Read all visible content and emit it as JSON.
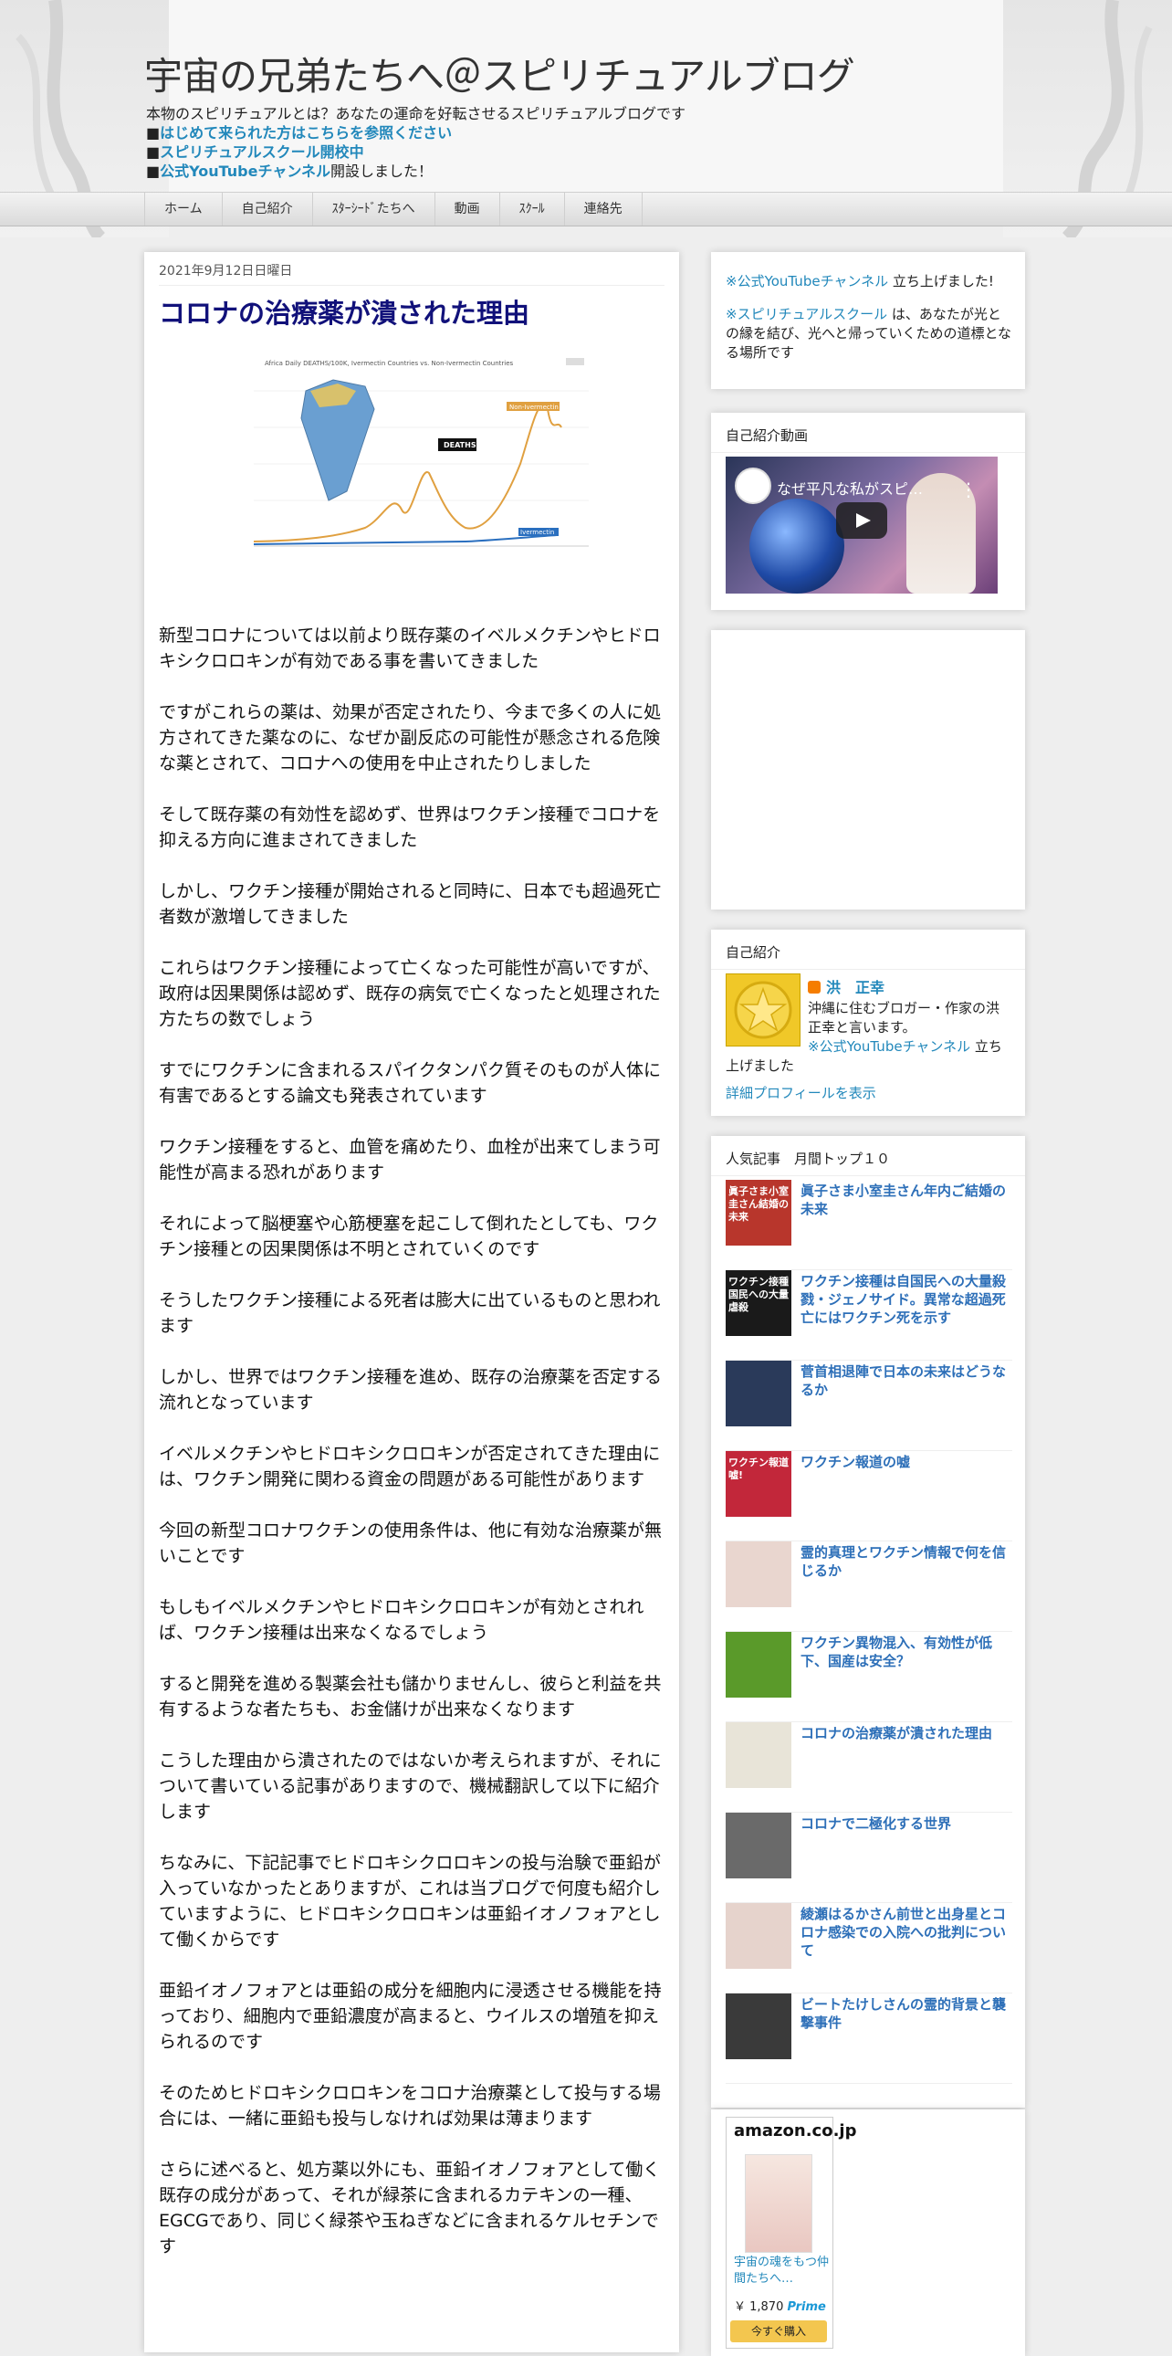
{
  "blog": {
    "title": "宇宙の兄弟たちへ＠スピリチュアルブログ",
    "description": "本物のスピリチュアルとは？あなたの運命を好転させるスピリチュアルブログです",
    "links": [
      {
        "bullet": "■",
        "text": "はじめて来られた方はこちらを参照ください",
        "suffix": ""
      },
      {
        "bullet": "■",
        "text": "スピリチュアルスクール開校中",
        "suffix": ""
      },
      {
        "bullet": "■",
        "text": "公式YouTubeチャンネル",
        "suffix": "開設しました！"
      }
    ]
  },
  "nav": {
    "tabs": [
      "ホーム",
      "自己紹介",
      "ｽﾀｰｼｰﾄﾞたちへ",
      "動画",
      "ｽｸｰﾙ",
      "連絡先"
    ]
  },
  "post": {
    "date": "2021年9月12日日曜日",
    "title": "コロナの治療薬が潰された理由",
    "image": {
      "chart_title": "Africa Daily DEATHS/100K, Ivermectin Countries vs. Non-Ivermectin Countries",
      "label_deaths": "DEATHS",
      "label_non": "Non-Ivermectin",
      "label_iver": "Ivermectin"
    },
    "paragraphs": [
      "新型コロナについては以前より既存薬のイベルメクチンやヒドロキシクロロキンが有効である事を書いてきました",
      "ですがこれらの薬は、効果が否定されたり、今まで多くの人に処方されてきた薬なのに、なぜか副反応の可能性が懸念される危険な薬とされて、コロナへの使用を中止されたりしました",
      "そして既存薬の有効性を認めず、世界はワクチン接種でコロナを抑える方向に進まされてきました",
      "しかし、ワクチン接種が開始されると同時に、日本でも超過死亡者数が激増してきました",
      "これらはワクチン接種によって亡くなった可能性が高いですが、政府は因果関係は認めず、既存の病気で亡くなったと処理された方たちの数でしょう",
      "すでにワクチンに含まれるスパイクタンパク質そのものが人体に有害であるとする論文も発表されています",
      "ワクチン接種をすると、血管を痛めたり、血栓が出来てしまう可能性が高まる恐れがあります",
      "それによって脳梗塞や心筋梗塞を起こして倒れたとしても、ワクチン接種との因果関係は不明とされていくのです",
      "そうしたワクチン接種による死者は膨大に出ているものと思われます",
      "しかし、世界ではワクチン接種を進め、既存の治療薬を否定する流れとなっています",
      "イベルメクチンやヒドロキシクロロキンが否定されてきた理由には、ワクチン開発に関わる資金の問題がある可能性があります",
      "今回の新型コロナワクチンの使用条件は、他に有効な治療薬が無いことです",
      "もしもイベルメクチンやヒドロキシクロロキンが有効とされれば、ワクチン接種は出来なくなるでしょう",
      "すると開発を進める製薬会社も儲かりませんし、彼らと利益を共有するような者たちも、お金儲けが出来なくなります",
      "こうした理由から潰されたのではないか考えられますが、それについて書いている記事がありますので、機械翻訳して以下に紹介します",
      "ちなみに、下記記事でヒドロキシクロロキンの投与治験で亜鉛が入っていなかったとありますが、これは当ブログで何度も紹介していますように、ヒドロキシクロロキンは亜鉛イオノフォアとして働くからです",
      "亜鉛イオノフォアとは亜鉛の成分を細胞内に浸透させる機能を持っており、細胞内で亜鉛濃度が高まると、ウイルスの増殖を抑えられるのです",
      "そのためヒドロキシクロロキンをコロナ治療薬として投与する場合には、一緒に亜鉛も投与しなければ効果は薄まります",
      "さらに述べると、処方薬以外にも、亜鉛イオノフォアとして働く既存の成分があって、それが緑茶に含まれるカテキンの一種、EGCGであり、同じく緑茶や玉ねぎなどに含まれるケルセチンです"
    ]
  },
  "sidebar": {
    "announce": {
      "item1_link": "※公式YouTubeチャンネル",
      "item1_text": " 立ち上げました!",
      "item2_link": "※スピリチュアルスクール",
      "item2_text": " は、あなたが光との縁を結び、光へと帰っていくための道標となる場所です"
    },
    "video": {
      "heading": "自己紹介動画",
      "title": "なぜ平凡な私がスピ…",
      "menu": "⋮"
    },
    "profile": {
      "heading": "自己紹介",
      "name": "洪　正幸",
      "text_lines": [
        "沖縄に住むブロガー・作家の洪",
        "正幸と言います。",
        "※公式YouTubeチャンネル"
      ],
      "text_tail": " 立ち",
      "text_end": "上げました",
      "link": "詳細プロフィールを表示"
    },
    "popular": {
      "heading": "人気記事　月間トップ１０",
      "items": [
        {
          "title": "眞子さま小室圭さん年内ご結婚の未来",
          "thumb_text": "眞子さま小室圭さん結婚の未来",
          "color": "#b8362c"
        },
        {
          "title": "ワクチン接種は自国民への大量殺戮・ジェノサイド。異常な超過死亡にはワクチン死を示す",
          "thumb_text": "ワクチン接種国民への大量虐殺",
          "color": "#1a1a1a"
        },
        {
          "title": "菅首相退陣で日本の未来はどうなるか",
          "thumb_text": "",
          "color": "#2a3a5a"
        },
        {
          "title": "ワクチン報道の嘘",
          "thumb_text": "ワクチン報道嘘!",
          "color": "#c2273a"
        },
        {
          "title": "霊的真理とワクチン情報で何を信じるか",
          "thumb_text": "",
          "color": "#e9d6cf"
        },
        {
          "title": "ワクチン異物混入、有効性が低下、国産は安全？",
          "thumb_text": "",
          "color": "#5a9a2a"
        },
        {
          "title": "コロナの治療薬が潰された理由",
          "thumb_text": "",
          "color": "#e8e4d8"
        },
        {
          "title": "コロナで二極化する世界",
          "thumb_text": "",
          "color": "#6a6a6a"
        },
        {
          "title": "綾瀬はるかさん前世と出身星とコロナ感染での入院への批判について",
          "thumb_text": "",
          "color": "#e6d3cc"
        },
        {
          "title": "ビートたけしさんの霊的背景と襲撃事件",
          "thumb_text": "",
          "color": "#3a3a3a"
        }
      ]
    },
    "amazon": {
      "logo": "amazon.co.jp",
      "book_title": "宇宙の魂をもつ仲間たちへ…",
      "price": "￥ 1,870",
      "prime": "Prime",
      "buy": "今すぐ購入"
    }
  },
  "colors": {
    "link": "#2288bb",
    "post_title": "#11117a",
    "popular_link": "#2d6fb8"
  }
}
